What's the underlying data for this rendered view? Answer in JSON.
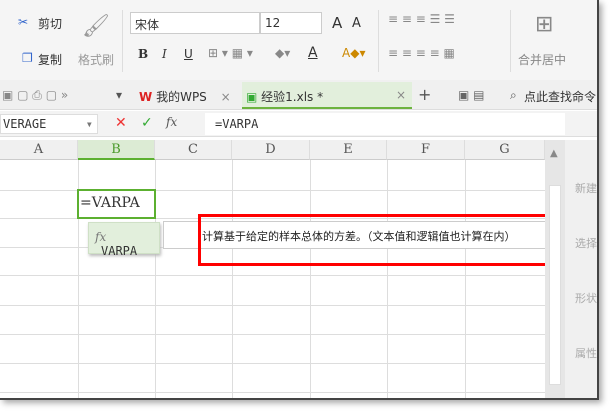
{
  "ribbon": {
    "cut": "剪切",
    "copy": "复制",
    "format_painter": "格式刷",
    "font_name": "宋体",
    "font_size": "12",
    "bold": "B",
    "italic": "I",
    "underline": "U",
    "font_color": "A",
    "grow": "A",
    "shrink": "A",
    "merge_center": "合并居中"
  },
  "tabs": [
    {
      "label": "我的WPS"
    },
    {
      "label": "经验1.xls *"
    }
  ],
  "search_placeholder": "点此查找命令",
  "formula_bar": {
    "name_box": "VERAGE",
    "fx": "fx",
    "formula": "=VARPA"
  },
  "columns": [
    "A",
    "B",
    "C",
    "D",
    "E",
    "F",
    "G"
  ],
  "active_cell": {
    "value": "=VARPA"
  },
  "autocomplete": {
    "fx": "fx",
    "function": "VARPA",
    "description": "计算基于给定的样本总体的方差。（文本值和逻辑值也计算在内）"
  },
  "highlight_color": "#ff0000",
  "side_panel": [
    "新建",
    "选择",
    "形状",
    "属性"
  ]
}
